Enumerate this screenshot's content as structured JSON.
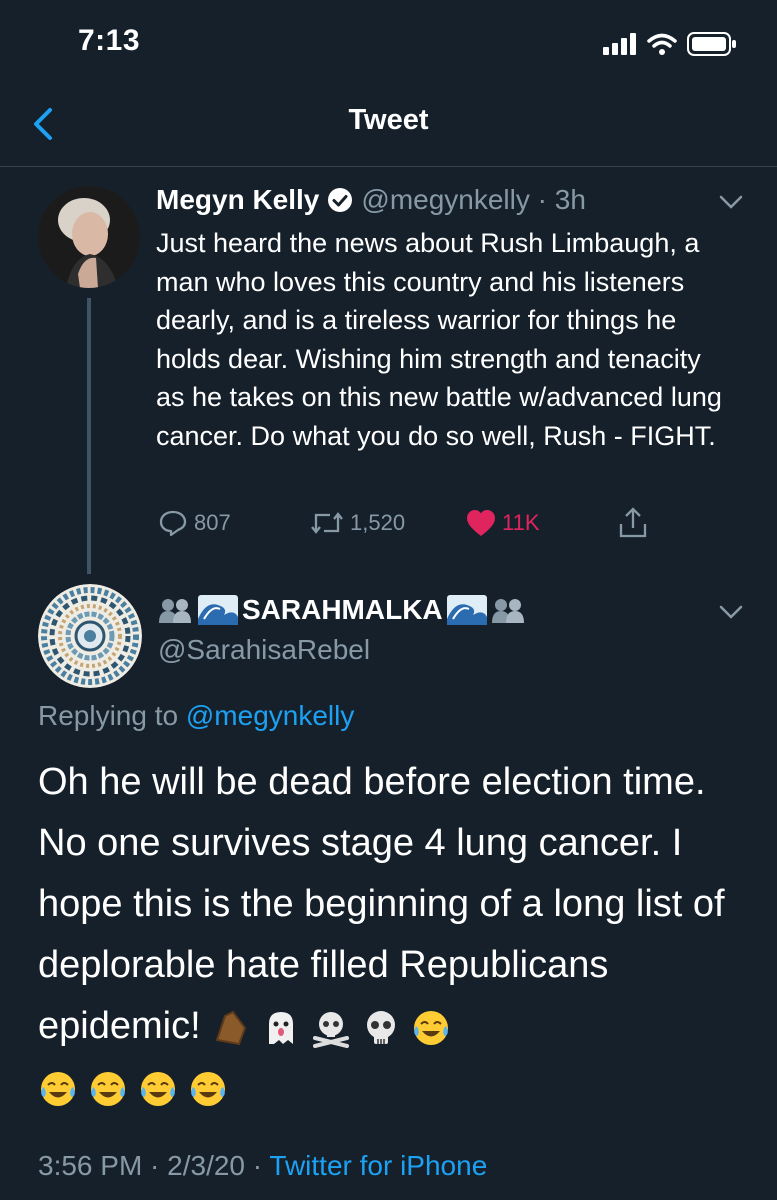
{
  "status_bar": {
    "time": "7:13"
  },
  "nav": {
    "title": "Tweet"
  },
  "tweet": {
    "author_name": "Megyn Kelly",
    "handle": "@megynkelly",
    "time_ago": "3h",
    "text": "Just heard the news about Rush Limbaugh, a man who loves this country and his listeners dearly, and is a tireless warrior for things he holds dear. Wishing him strength and tenacity as he takes on this new battle w/advanced lung cancer. Do what you do so well, Rush - FIGHT.",
    "replies": "807",
    "retweets": "1,520",
    "likes": "11K",
    "like_color": "#e0245e"
  },
  "reply": {
    "author_name": "SARAHMALKA",
    "handle": "@SarahisaRebel",
    "replying_prefix": "Replying to",
    "replying_to": "@megynkelly",
    "text": "Oh he will be dead before election time. No one survives stage 4 lung cancer. I hope this is the beginning of a long list of deplorable hate filled Republicans epidemic!",
    "timestamp": "3:56 PM · 2/3/20 ·",
    "client": "Twitter for iPhone",
    "emojis": [
      "coffin-emoji",
      "ghost-emoji",
      "skull-crossbones-emoji",
      "skull-emoji",
      "tears-of-joy-emoji",
      "tears-of-joy-emoji",
      "tears-of-joy-emoji",
      "tears-of-joy-emoji",
      "tears-of-joy-emoji"
    ]
  },
  "colors": {
    "background": "#15202b",
    "accent": "#1da1f2",
    "secondary_text": "#8899a6"
  }
}
